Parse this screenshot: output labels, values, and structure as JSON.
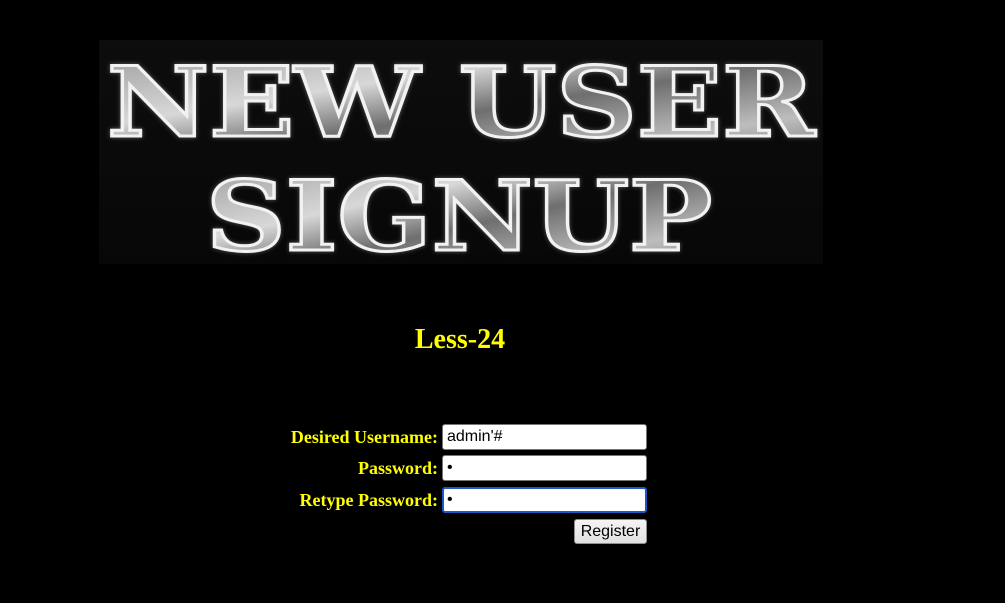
{
  "banner": {
    "line1": "NEW USER",
    "line2": "SIGNUP"
  },
  "lesson_title": "Less-24",
  "form": {
    "username_label": "Desired Username:",
    "username_value": "admin'#",
    "password_label": "Password:",
    "password_value": "a",
    "retype_label": "Retype Password:",
    "retype_value": "a",
    "register_label": "Register"
  },
  "colors": {
    "background": "#000000",
    "label_text": "#ffff00",
    "focus_border": "#1a57c7"
  }
}
